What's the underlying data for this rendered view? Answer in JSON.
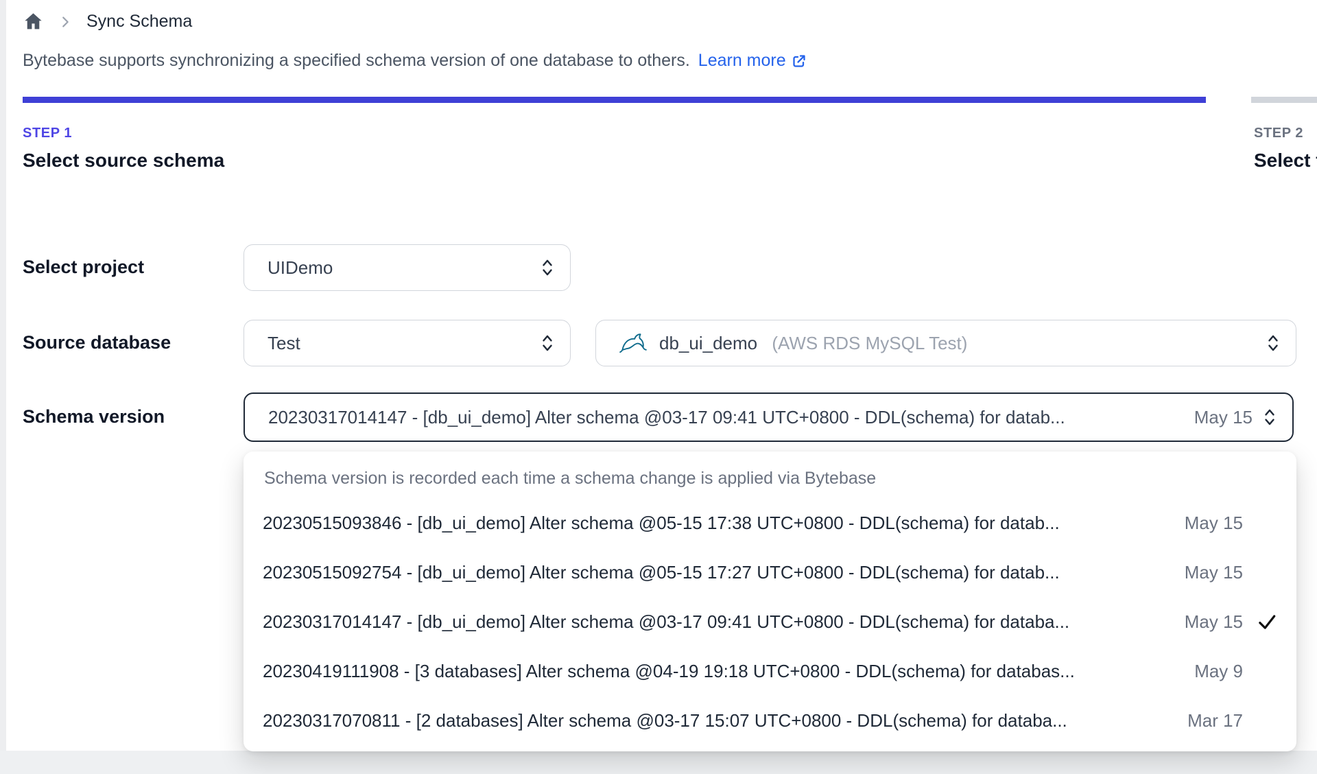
{
  "breadcrumb": {
    "title": "Sync Schema"
  },
  "intro": {
    "text": "Bytebase supports synchronizing a specified schema version of one database to others.",
    "link_label": "Learn more"
  },
  "steps": [
    {
      "step_label": "STEP 1",
      "title": "Select source schema",
      "state": "active"
    },
    {
      "step_label": "STEP 2",
      "title": "Select t",
      "state": "upcoming"
    }
  ],
  "form": {
    "project": {
      "label": "Select project",
      "value": "UIDemo"
    },
    "source_database": {
      "label": "Source database",
      "environment_value": "Test",
      "database_value": "db_ui_demo",
      "database_detail": "(AWS RDS MySQL Test)",
      "database_engine_icon": "mysql-dolphin-icon"
    },
    "schema_version": {
      "label": "Schema version",
      "value": "20230317014147 - [db_ui_demo] Alter schema @03-17 09:41 UTC+0800 - DDL(schema) for datab...",
      "date": "May 15"
    }
  },
  "dropdown": {
    "header": "Schema version is recorded each time a schema change is applied via Bytebase",
    "options": [
      {
        "text": "20230515093846 - [db_ui_demo] Alter schema @05-15 17:38 UTC+0800 - DDL(schema) for datab...",
        "date": "May 15",
        "selected": false
      },
      {
        "text": "20230515092754 - [db_ui_demo] Alter schema @05-15 17:27 UTC+0800 - DDL(schema) for datab...",
        "date": "May 15",
        "selected": false
      },
      {
        "text": "20230317014147 - [db_ui_demo] Alter schema @03-17 09:41 UTC+0800 - DDL(schema) for databa...",
        "date": "May 15",
        "selected": true
      },
      {
        "text": "20230419111908 - [3 databases] Alter schema @04-19 19:18 UTC+0800 - DDL(schema) for databas...",
        "date": "May 9",
        "selected": false
      },
      {
        "text": "20230317070811 - [2 databases] Alter schema @03-17 15:07 UTC+0800 - DDL(schema) for databa...",
        "date": "Mar 17",
        "selected": false
      }
    ]
  },
  "colors": {
    "accent": "#4f46e5",
    "accent_bar": "#3f40d6",
    "link": "#2563eb",
    "bar_upcoming": "#d1d5db",
    "focus_border": "#1f2937",
    "mysql_icon": "#0e6b8c"
  }
}
